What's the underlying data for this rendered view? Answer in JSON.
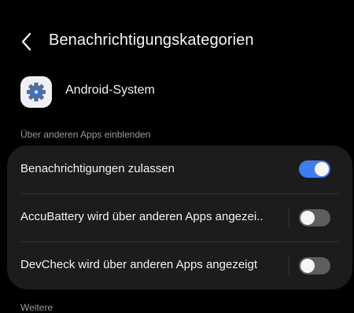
{
  "header": {
    "title": "Benachrichtigungskategorien",
    "back_icon": "chevron-left-icon"
  },
  "app": {
    "name": "Android-System",
    "icon": "gear-icon"
  },
  "section": {
    "label": "Über anderen Apps einblenden"
  },
  "settings": [
    {
      "label": "Benachrichtigungen zulassen",
      "enabled": true
    },
    {
      "label": "AccuBattery wird über anderen Apps angezei..",
      "enabled": false
    },
    {
      "label": "DevCheck wird über anderen Apps angezeigt",
      "enabled": false
    }
  ],
  "footer": {
    "label": "Weitere"
  },
  "colors": {
    "background": "#000000",
    "card": "#1c1c1c",
    "accent": "#3e7cf2",
    "toggle_off": "#5e5e5e",
    "secondary_text": "#9a9a9a"
  }
}
